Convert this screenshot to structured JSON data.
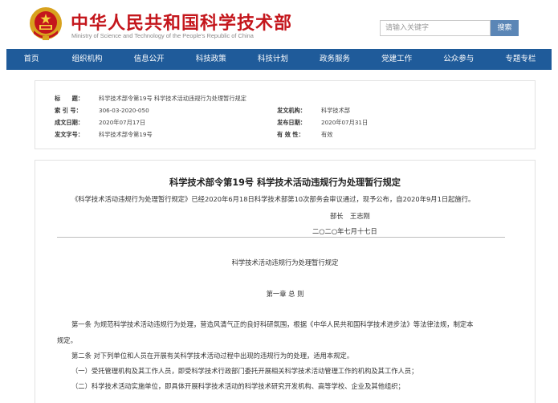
{
  "header": {
    "site_title": "中华人民共和国科学技术部",
    "site_subtitle": "Ministry of Science and Technology of the People's Republic of China",
    "search_placeholder": "请输入关键字",
    "search_button": "搜索",
    "colors": {
      "brand_red": "#c4161c",
      "nav_blue": "#1f5b9a",
      "search_button": "#5b86b6"
    }
  },
  "nav": {
    "items": [
      "首页",
      "组织机构",
      "信息公开",
      "科技政策",
      "科技计划",
      "政务服务",
      "党建工作",
      "公众参与",
      "专题专栏"
    ]
  },
  "meta": {
    "title_label": "标　　题：",
    "title_value": "科学技术部令第19号 科学技术活动违规行为处理暂行规定",
    "index_label": "索 引 号：",
    "index_value": "306-03-2020-050",
    "issuer_label": "发文机构：",
    "issuer_value": "科学技术部",
    "created_label": "成文日期：",
    "created_value": "2020年07月17日",
    "published_label": "发布日期：",
    "published_value": "2020年07月31日",
    "docno_label": "发文字号：",
    "docno_value": "科学技术部令第19号",
    "validity_label": "有 效 性：",
    "validity_value": "有效"
  },
  "article": {
    "title": "科学技术部令第19号 科学技术活动违规行为处理暂行规定",
    "intro": "《科学技术活动违规行为处理暂行规定》已经2020年6月18日科学技术部第10次部务会审议通过，现予公布，自2020年9月1日起施行。",
    "signer": "部长　王志刚",
    "date": "二○二○年七月十七日",
    "doc_title": "科学技术活动违规行为处理暂行规定",
    "chapter": "第一章 总 则",
    "article1_a": "第一条 为规范科学技术活动违规行为处理，营造风清气正的良好科研氛围，根据《中华人民共和国科学技术进步法》等法律法规，制定本",
    "article1_b": "规定。",
    "article2": "第二条 对下列单位和人员在开展有关科学技术活动过程中出现的违规行为的处理，适用本规定。",
    "item1": "（一）受托管理机构及其工作人员，即受科学技术行政部门委托开展相关科学技术活动管理工作的机构及其工作人员；",
    "item2": "（二）科学技术活动实施单位，即具体开展科学技术活动的科学技术研究开发机构、高等学校、企业及其他组织；"
  }
}
